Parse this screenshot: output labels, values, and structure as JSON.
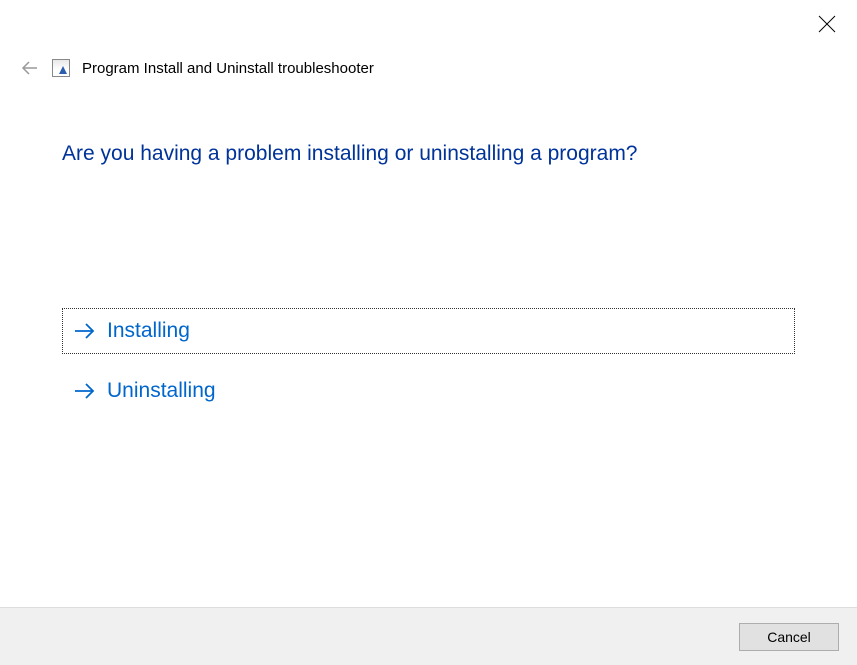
{
  "header": {
    "title": "Program Install and Uninstall troubleshooter"
  },
  "main": {
    "heading": "Are you having a problem installing or uninstalling a program?",
    "options": [
      {
        "label": "Installing"
      },
      {
        "label": "Uninstalling"
      }
    ]
  },
  "footer": {
    "cancel_label": "Cancel"
  }
}
